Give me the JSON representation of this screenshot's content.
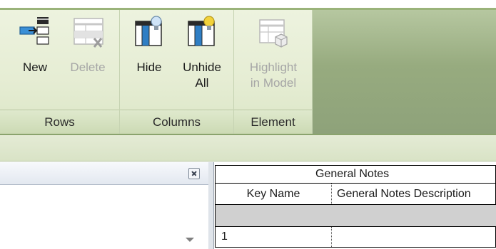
{
  "ribbon": {
    "panels": [
      {
        "label": "Rows",
        "tools": [
          {
            "label": "New",
            "icon": "new-row-icon",
            "enabled": true
          },
          {
            "label": "Delete",
            "icon": "delete-row-icon",
            "enabled": false
          }
        ]
      },
      {
        "label": "Columns",
        "tools": [
          {
            "label": "Hide",
            "icon": "hide-column-icon",
            "enabled": true
          },
          {
            "label": "Unhide\nAll",
            "icon": "unhide-all-columns-icon",
            "enabled": true
          }
        ]
      },
      {
        "label": "Element",
        "tools": [
          {
            "label": "Highlight\nin Model",
            "icon": "highlight-in-model-icon",
            "enabled": false
          }
        ]
      }
    ]
  },
  "dock": {
    "close_icon": "close-icon",
    "dropdown_icon": "chevron-down-icon"
  },
  "schedule": {
    "title": "General Notes",
    "columns": [
      "Key Name",
      "General Notes Description"
    ],
    "rows": [
      {
        "key": "1",
        "description": ""
      }
    ]
  },
  "colors": {
    "ribbon_bg": "#e6edd4",
    "ribbon_fill": "#97ab7f",
    "icon_blue": "#2f7ec4",
    "icon_yellow": "#f2d23a",
    "disabled_text": "#a6a6a6"
  }
}
